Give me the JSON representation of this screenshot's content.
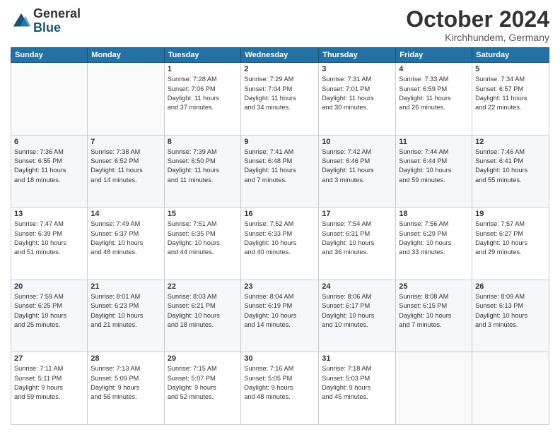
{
  "header": {
    "logo_general": "General",
    "logo_blue": "Blue",
    "month_title": "October 2024",
    "location": "Kirchhundem, Germany"
  },
  "weekdays": [
    "Sunday",
    "Monday",
    "Tuesday",
    "Wednesday",
    "Thursday",
    "Friday",
    "Saturday"
  ],
  "weeks": [
    [
      {
        "day": "",
        "info": ""
      },
      {
        "day": "",
        "info": ""
      },
      {
        "day": "1",
        "info": "Sunrise: 7:28 AM\nSunset: 7:06 PM\nDaylight: 11 hours\nand 37 minutes."
      },
      {
        "day": "2",
        "info": "Sunrise: 7:29 AM\nSunset: 7:04 PM\nDaylight: 11 hours\nand 34 minutes."
      },
      {
        "day": "3",
        "info": "Sunrise: 7:31 AM\nSunset: 7:01 PM\nDaylight: 11 hours\nand 30 minutes."
      },
      {
        "day": "4",
        "info": "Sunrise: 7:33 AM\nSunset: 6:59 PM\nDaylight: 11 hours\nand 26 minutes."
      },
      {
        "day": "5",
        "info": "Sunrise: 7:34 AM\nSunset: 6:57 PM\nDaylight: 11 hours\nand 22 minutes."
      }
    ],
    [
      {
        "day": "6",
        "info": "Sunrise: 7:36 AM\nSunset: 6:55 PM\nDaylight: 11 hours\nand 18 minutes."
      },
      {
        "day": "7",
        "info": "Sunrise: 7:38 AM\nSunset: 6:52 PM\nDaylight: 11 hours\nand 14 minutes."
      },
      {
        "day": "8",
        "info": "Sunrise: 7:39 AM\nSunset: 6:50 PM\nDaylight: 11 hours\nand 11 minutes."
      },
      {
        "day": "9",
        "info": "Sunrise: 7:41 AM\nSunset: 6:48 PM\nDaylight: 11 hours\nand 7 minutes."
      },
      {
        "day": "10",
        "info": "Sunrise: 7:42 AM\nSunset: 6:46 PM\nDaylight: 11 hours\nand 3 minutes."
      },
      {
        "day": "11",
        "info": "Sunrise: 7:44 AM\nSunset: 6:44 PM\nDaylight: 10 hours\nand 59 minutes."
      },
      {
        "day": "12",
        "info": "Sunrise: 7:46 AM\nSunset: 6:41 PM\nDaylight: 10 hours\nand 55 minutes."
      }
    ],
    [
      {
        "day": "13",
        "info": "Sunrise: 7:47 AM\nSunset: 6:39 PM\nDaylight: 10 hours\nand 51 minutes."
      },
      {
        "day": "14",
        "info": "Sunrise: 7:49 AM\nSunset: 6:37 PM\nDaylight: 10 hours\nand 48 minutes."
      },
      {
        "day": "15",
        "info": "Sunrise: 7:51 AM\nSunset: 6:35 PM\nDaylight: 10 hours\nand 44 minutes."
      },
      {
        "day": "16",
        "info": "Sunrise: 7:52 AM\nSunset: 6:33 PM\nDaylight: 10 hours\nand 40 minutes."
      },
      {
        "day": "17",
        "info": "Sunrise: 7:54 AM\nSunset: 6:31 PM\nDaylight: 10 hours\nand 36 minutes."
      },
      {
        "day": "18",
        "info": "Sunrise: 7:56 AM\nSunset: 6:29 PM\nDaylight: 10 hours\nand 33 minutes."
      },
      {
        "day": "19",
        "info": "Sunrise: 7:57 AM\nSunset: 6:27 PM\nDaylight: 10 hours\nand 29 minutes."
      }
    ],
    [
      {
        "day": "20",
        "info": "Sunrise: 7:59 AM\nSunset: 6:25 PM\nDaylight: 10 hours\nand 25 minutes."
      },
      {
        "day": "21",
        "info": "Sunrise: 8:01 AM\nSunset: 6:23 PM\nDaylight: 10 hours\nand 21 minutes."
      },
      {
        "day": "22",
        "info": "Sunrise: 8:03 AM\nSunset: 6:21 PM\nDaylight: 10 hours\nand 18 minutes."
      },
      {
        "day": "23",
        "info": "Sunrise: 8:04 AM\nSunset: 6:19 PM\nDaylight: 10 hours\nand 14 minutes."
      },
      {
        "day": "24",
        "info": "Sunrise: 8:06 AM\nSunset: 6:17 PM\nDaylight: 10 hours\nand 10 minutes."
      },
      {
        "day": "25",
        "info": "Sunrise: 8:08 AM\nSunset: 6:15 PM\nDaylight: 10 hours\nand 7 minutes."
      },
      {
        "day": "26",
        "info": "Sunrise: 8:09 AM\nSunset: 6:13 PM\nDaylight: 10 hours\nand 3 minutes."
      }
    ],
    [
      {
        "day": "27",
        "info": "Sunrise: 7:11 AM\nSunset: 5:11 PM\nDaylight: 9 hours\nand 59 minutes."
      },
      {
        "day": "28",
        "info": "Sunrise: 7:13 AM\nSunset: 5:09 PM\nDaylight: 9 hours\nand 56 minutes."
      },
      {
        "day": "29",
        "info": "Sunrise: 7:15 AM\nSunset: 5:07 PM\nDaylight: 9 hours\nand 52 minutes."
      },
      {
        "day": "30",
        "info": "Sunrise: 7:16 AM\nSunset: 5:05 PM\nDaylight: 9 hours\nand 48 minutes."
      },
      {
        "day": "31",
        "info": "Sunrise: 7:18 AM\nSunset: 5:03 PM\nDaylight: 9 hours\nand 45 minutes."
      },
      {
        "day": "",
        "info": ""
      },
      {
        "day": "",
        "info": ""
      }
    ]
  ]
}
